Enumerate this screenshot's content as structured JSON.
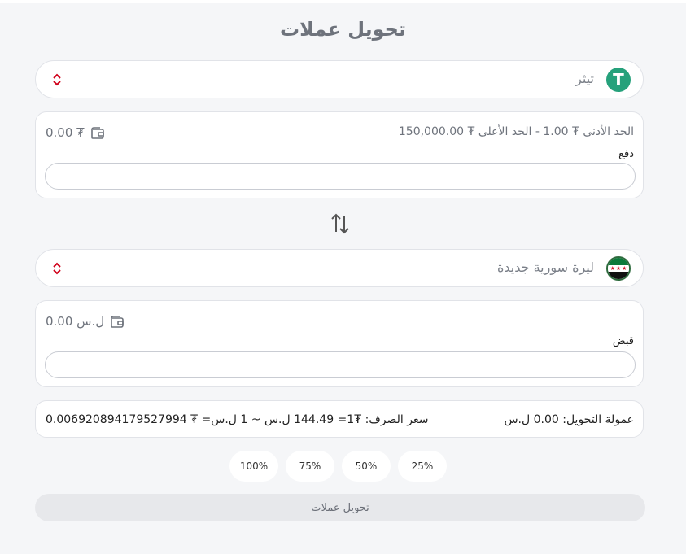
{
  "page": {
    "title": "تحويل عملات"
  },
  "from": {
    "currency": "تيثر",
    "logo_symbol": "T",
    "limits": "الحد الأدنى ₮ 1.00   -   الحد الأعلى ₮ 150,000.00",
    "balance": "0.00 ₮",
    "field_label": "دفع",
    "amount_value": ""
  },
  "to": {
    "currency": "ليرة سورية جديدة",
    "balance": "0.00 ل.س",
    "field_label": "قبض",
    "amount_value": ""
  },
  "summary": {
    "fee": "عمولة التحويل: 0.00 ل.س",
    "rate": "سعر الصرف: ₮1= 144.49 ل.س ~ 1 ل.س= ₮ 0.006920894179527994"
  },
  "percent_buttons": [
    "25%",
    "50%",
    "75%",
    "100%"
  ],
  "submit_label": "تحويل عملات",
  "colors": {
    "tether": "#26a17b",
    "chevron": "#d0021b",
    "background": "#f5f6f8"
  }
}
